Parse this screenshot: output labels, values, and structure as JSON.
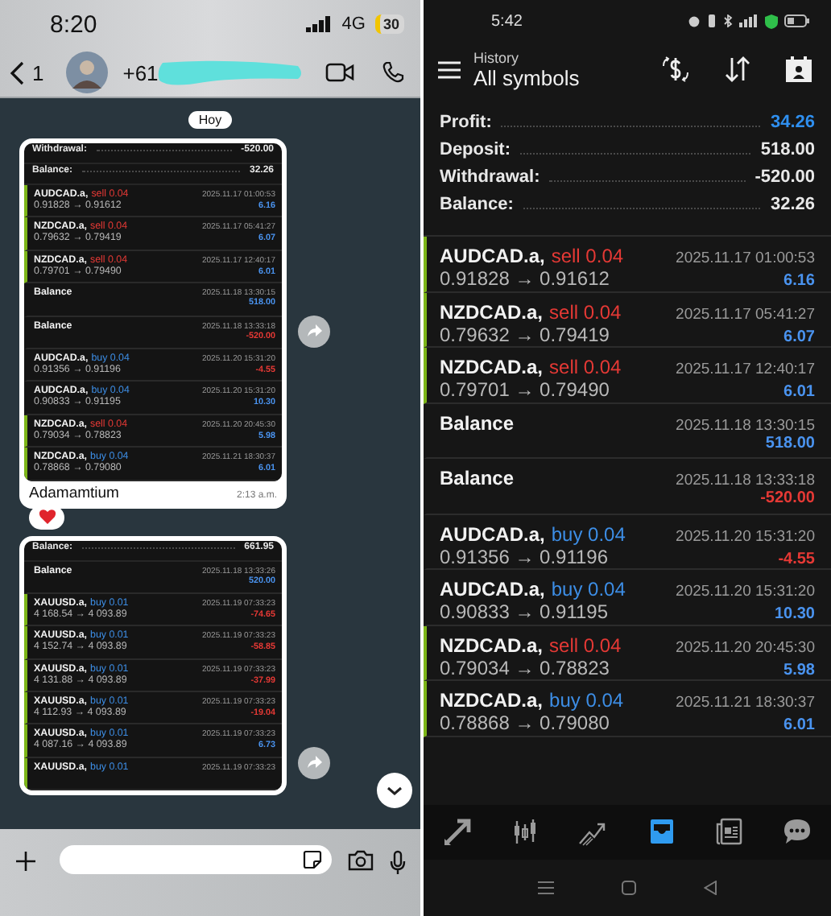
{
  "whatsapp": {
    "status_bar": {
      "time": "8:20",
      "network": "4G",
      "battery": "30"
    },
    "header": {
      "back_badge": "1",
      "contact": "+61"
    },
    "date_chip": "Hoy",
    "messages": [
      {
        "summary": [
          {
            "label": "Withdrawal:",
            "value": "-520.00",
            "highlight": false
          },
          {
            "label": "Balance:",
            "value": "32.26",
            "highlight": false
          }
        ],
        "deals": [
          {
            "kind": "trade",
            "symbol": "AUDCAD.a,",
            "side": "sell",
            "volume": "0.04",
            "color": "#e53935",
            "prices": "0.91828 → 0.91612",
            "time": "2025.11.17 01:00:53",
            "profit": "6.16",
            "negative": false,
            "marked": true
          },
          {
            "kind": "trade",
            "symbol": "NZDCAD.a,",
            "side": "sell",
            "volume": "0.04",
            "color": "#e53935",
            "prices": "0.79632 → 0.79419",
            "time": "2025.11.17 05:41:27",
            "profit": "6.07",
            "negative": false,
            "marked": true
          },
          {
            "kind": "trade",
            "symbol": "NZDCAD.a,",
            "side": "sell",
            "volume": "0.04",
            "color": "#e53935",
            "prices": "0.79701 → 0.79490",
            "time": "2025.11.17 12:40:17",
            "profit": "6.01",
            "negative": false,
            "marked": true
          },
          {
            "kind": "balance",
            "symbol": "Balance",
            "time": "2025.11.18 13:30:15",
            "profit": "518.00",
            "negative": false,
            "marked": false
          },
          {
            "kind": "balance",
            "symbol": "Balance",
            "time": "2025.11.18 13:33:18",
            "profit": "-520.00",
            "negative": true,
            "marked": false
          },
          {
            "kind": "trade",
            "symbol": "AUDCAD.a,",
            "side": "buy",
            "volume": "0.04",
            "color": "#3d8ee6",
            "prices": "0.91356 → 0.91196",
            "time": "2025.11.20 15:31:20",
            "profit": "-4.55",
            "negative": true,
            "marked": false
          },
          {
            "kind": "trade",
            "symbol": "AUDCAD.a,",
            "side": "buy",
            "volume": "0.04",
            "color": "#3d8ee6",
            "prices": "0.90833 → 0.91195",
            "time": "2025.11.20 15:31:20",
            "profit": "10.30",
            "negative": false,
            "marked": false
          },
          {
            "kind": "trade",
            "symbol": "NZDCAD.a,",
            "side": "sell",
            "volume": "0.04",
            "color": "#e53935",
            "prices": "0.79034 → 0.78823",
            "time": "2025.11.20 20:45:30",
            "profit": "5.98",
            "negative": false,
            "marked": true
          },
          {
            "kind": "trade",
            "symbol": "NZDCAD.a,",
            "side": "buy",
            "volume": "0.04",
            "color": "#3d8ee6",
            "prices": "0.78868 → 0.79080",
            "time": "2025.11.21 18:30:37",
            "profit": "6.01",
            "negative": false,
            "marked": true
          }
        ],
        "caption": "Adamamtium",
        "time": "2:13 a.m.",
        "reaction": true
      },
      {
        "summary": [
          {
            "label": "Balance:",
            "value": "661.95",
            "highlight": false
          }
        ],
        "deals": [
          {
            "kind": "balance",
            "symbol": "Balance",
            "time": "2025.11.18 13:33:26",
            "profit": "520.00",
            "negative": false,
            "marked": false
          },
          {
            "kind": "trade",
            "symbol": "XAUUSD.a,",
            "side": "buy",
            "volume": "0.01",
            "color": "#3d8ee6",
            "prices": "4 168.54 → 4 093.89",
            "time": "2025.11.19 07:33:23",
            "profit": "-74.65",
            "negative": true,
            "marked": true
          },
          {
            "kind": "trade",
            "symbol": "XAUUSD.a,",
            "side": "buy",
            "volume": "0.01",
            "color": "#3d8ee6",
            "prices": "4 152.74 → 4 093.89",
            "time": "2025.11.19 07:33:23",
            "profit": "-58.85",
            "negative": true,
            "marked": true
          },
          {
            "kind": "trade",
            "symbol": "XAUUSD.a,",
            "side": "buy",
            "volume": "0.01",
            "color": "#3d8ee6",
            "prices": "4 131.88 → 4 093.89",
            "time": "2025.11.19 07:33:23",
            "profit": "-37.99",
            "negative": true,
            "marked": true
          },
          {
            "kind": "trade",
            "symbol": "XAUUSD.a,",
            "side": "buy",
            "volume": "0.01",
            "color": "#3d8ee6",
            "prices": "4 112.93 → 4 093.89",
            "time": "2025.11.19 07:33:23",
            "profit": "-19.04",
            "negative": true,
            "marked": true
          },
          {
            "kind": "trade",
            "symbol": "XAUUSD.a,",
            "side": "buy",
            "volume": "0.01",
            "color": "#3d8ee6",
            "prices": "4 087.16 → 4 093.89",
            "time": "2025.11.19 07:33:23",
            "profit": "6.73",
            "negative": false,
            "marked": true
          },
          {
            "kind": "trade",
            "symbol": "XAUUSD.a,",
            "side": "buy",
            "volume": "0.01",
            "color": "#3d8ee6",
            "time": "2025.11.19 07:33:23",
            "marked": true
          }
        ],
        "reaction": false
      }
    ]
  },
  "mt4": {
    "status_bar": {
      "time": "5:42"
    },
    "header": {
      "subtitle": "History",
      "title": "All symbols"
    },
    "summary": [
      {
        "label": "Profit:",
        "value": "34.26",
        "highlight": true
      },
      {
        "label": "Deposit:",
        "value": "518.00",
        "highlight": false
      },
      {
        "label": "Withdrawal:",
        "value": "-520.00",
        "highlight": false
      },
      {
        "label": "Balance:",
        "value": "32.26",
        "highlight": false
      }
    ],
    "deals": [
      {
        "kind": "trade",
        "symbol": "AUDCAD.a,",
        "side": "sell",
        "volume": "0.04",
        "color": "#e53935",
        "prices": "0.91828 → 0.91612",
        "time": "2025.11.17 01:00:53",
        "profit": "6.16",
        "negative": false,
        "marked": true
      },
      {
        "kind": "trade",
        "symbol": "NZDCAD.a,",
        "side": "sell",
        "volume": "0.04",
        "color": "#e53935",
        "prices": "0.79632 → 0.79419",
        "time": "2025.11.17 05:41:27",
        "profit": "6.07",
        "negative": false,
        "marked": true
      },
      {
        "kind": "trade",
        "symbol": "NZDCAD.a,",
        "side": "sell",
        "volume": "0.04",
        "color": "#e53935",
        "prices": "0.79701 → 0.79490",
        "time": "2025.11.17 12:40:17",
        "profit": "6.01",
        "negative": false,
        "marked": true
      },
      {
        "kind": "balance",
        "symbol": "Balance",
        "time": "2025.11.18 13:30:15",
        "profit": "518.00",
        "negative": false,
        "marked": false
      },
      {
        "kind": "balance",
        "symbol": "Balance",
        "time": "2025.11.18 13:33:18",
        "profit": "-520.00",
        "negative": true,
        "marked": false
      },
      {
        "kind": "trade",
        "symbol": "AUDCAD.a,",
        "side": "buy",
        "volume": "0.04",
        "color": "#3d8ee6",
        "prices": "0.91356 → 0.91196",
        "time": "2025.11.20 15:31:20",
        "profit": "-4.55",
        "negative": true,
        "marked": false
      },
      {
        "kind": "trade",
        "symbol": "AUDCAD.a,",
        "side": "buy",
        "volume": "0.04",
        "color": "#3d8ee6",
        "prices": "0.90833 → 0.91195",
        "time": "2025.11.20 15:31:20",
        "profit": "10.30",
        "negative": false,
        "marked": false
      },
      {
        "kind": "trade",
        "symbol": "NZDCAD.a,",
        "side": "sell",
        "volume": "0.04",
        "color": "#e53935",
        "prices": "0.79034 → 0.78823",
        "time": "2025.11.20 20:45:30",
        "profit": "5.98",
        "negative": false,
        "marked": true
      },
      {
        "kind": "trade",
        "symbol": "NZDCAD.a,",
        "side": "buy",
        "volume": "0.04",
        "color": "#3d8ee6",
        "prices": "0.78868 → 0.79080",
        "time": "2025.11.21 18:30:37",
        "profit": "6.01",
        "negative": false,
        "marked": true
      }
    ],
    "bottom_nav": [
      {
        "kind": "trade",
        "selected": false
      },
      {
        "kind": "quotes",
        "selected": false
      },
      {
        "kind": "chart",
        "selected": false
      },
      {
        "kind": "history",
        "selected": true
      },
      {
        "kind": "news",
        "selected": false
      },
      {
        "kind": "chat",
        "selected": false
      }
    ]
  }
}
